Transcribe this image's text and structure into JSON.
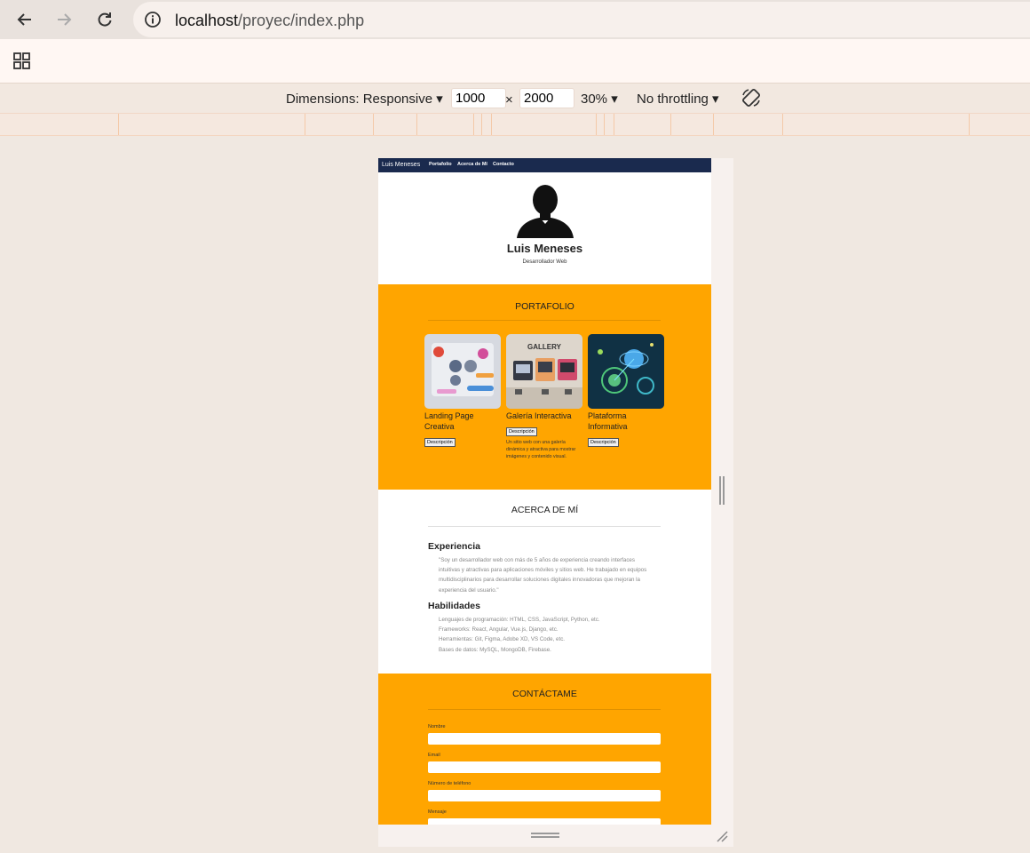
{
  "browser": {
    "url_host": "localhost",
    "url_path": "/proyec/index.php"
  },
  "devtools": {
    "dimensions_label": "Dimensions: Responsive",
    "width_value": "1000",
    "times": "×",
    "height_value": "2000",
    "zoom_label": "30%",
    "throttling_label": "No throttling"
  },
  "site": {
    "nav": {
      "brand": "Luis Meneses",
      "links": [
        "Portafolio",
        "Acerca de Mí",
        "Contacto"
      ]
    },
    "hero": {
      "name": "Luis Meneses",
      "subtitle": "Desarrollador Web"
    },
    "portfolio": {
      "title": "PORTAFOLIO",
      "cards": [
        {
          "title": "Landing Page Creativa",
          "button": "Descripción",
          "description": ""
        },
        {
          "title": "Galería Interactiva",
          "button": "Descripción",
          "description": "Un sitio web con una galería dinámica y atractiva para mostrar imágenes y contenido visual.",
          "thumb_text": "GALLERY"
        },
        {
          "title": "Plataforma Informativa",
          "button": "Descripción",
          "description": ""
        }
      ]
    },
    "about": {
      "title": "ACERCA DE MÍ",
      "experience_heading": "Experiencia",
      "experience_text": "\"Soy un desarrollador web con más de 5 años de experiencia creando interfaces intuitivas y atractivas para aplicaciones móviles y sitios web. He trabajado en equipos multidisciplinarios para desarrollar soluciones digitales innovadoras que mejoran la experiencia del usuario.\"",
      "skills_heading": "Habilidades",
      "skills": [
        "Lenguajes de programación: HTML, CSS, JavaScript, Python, etc.",
        "Frameworks: React, Angular, Vue.js, Django, etc.",
        "Herramientas: Git, Figma, Adobe XD, VS Code, etc.",
        "Bases de datos: MySQL, MongoDB, Firebase."
      ]
    },
    "contact": {
      "title": "CONTÁCTAME",
      "fields": [
        "Nombre",
        "Email",
        "Número de teléfono",
        "Mensaje"
      ]
    }
  },
  "colors": {
    "nav_bg": "#1a2a4e",
    "section_accent": "#ffa500"
  }
}
